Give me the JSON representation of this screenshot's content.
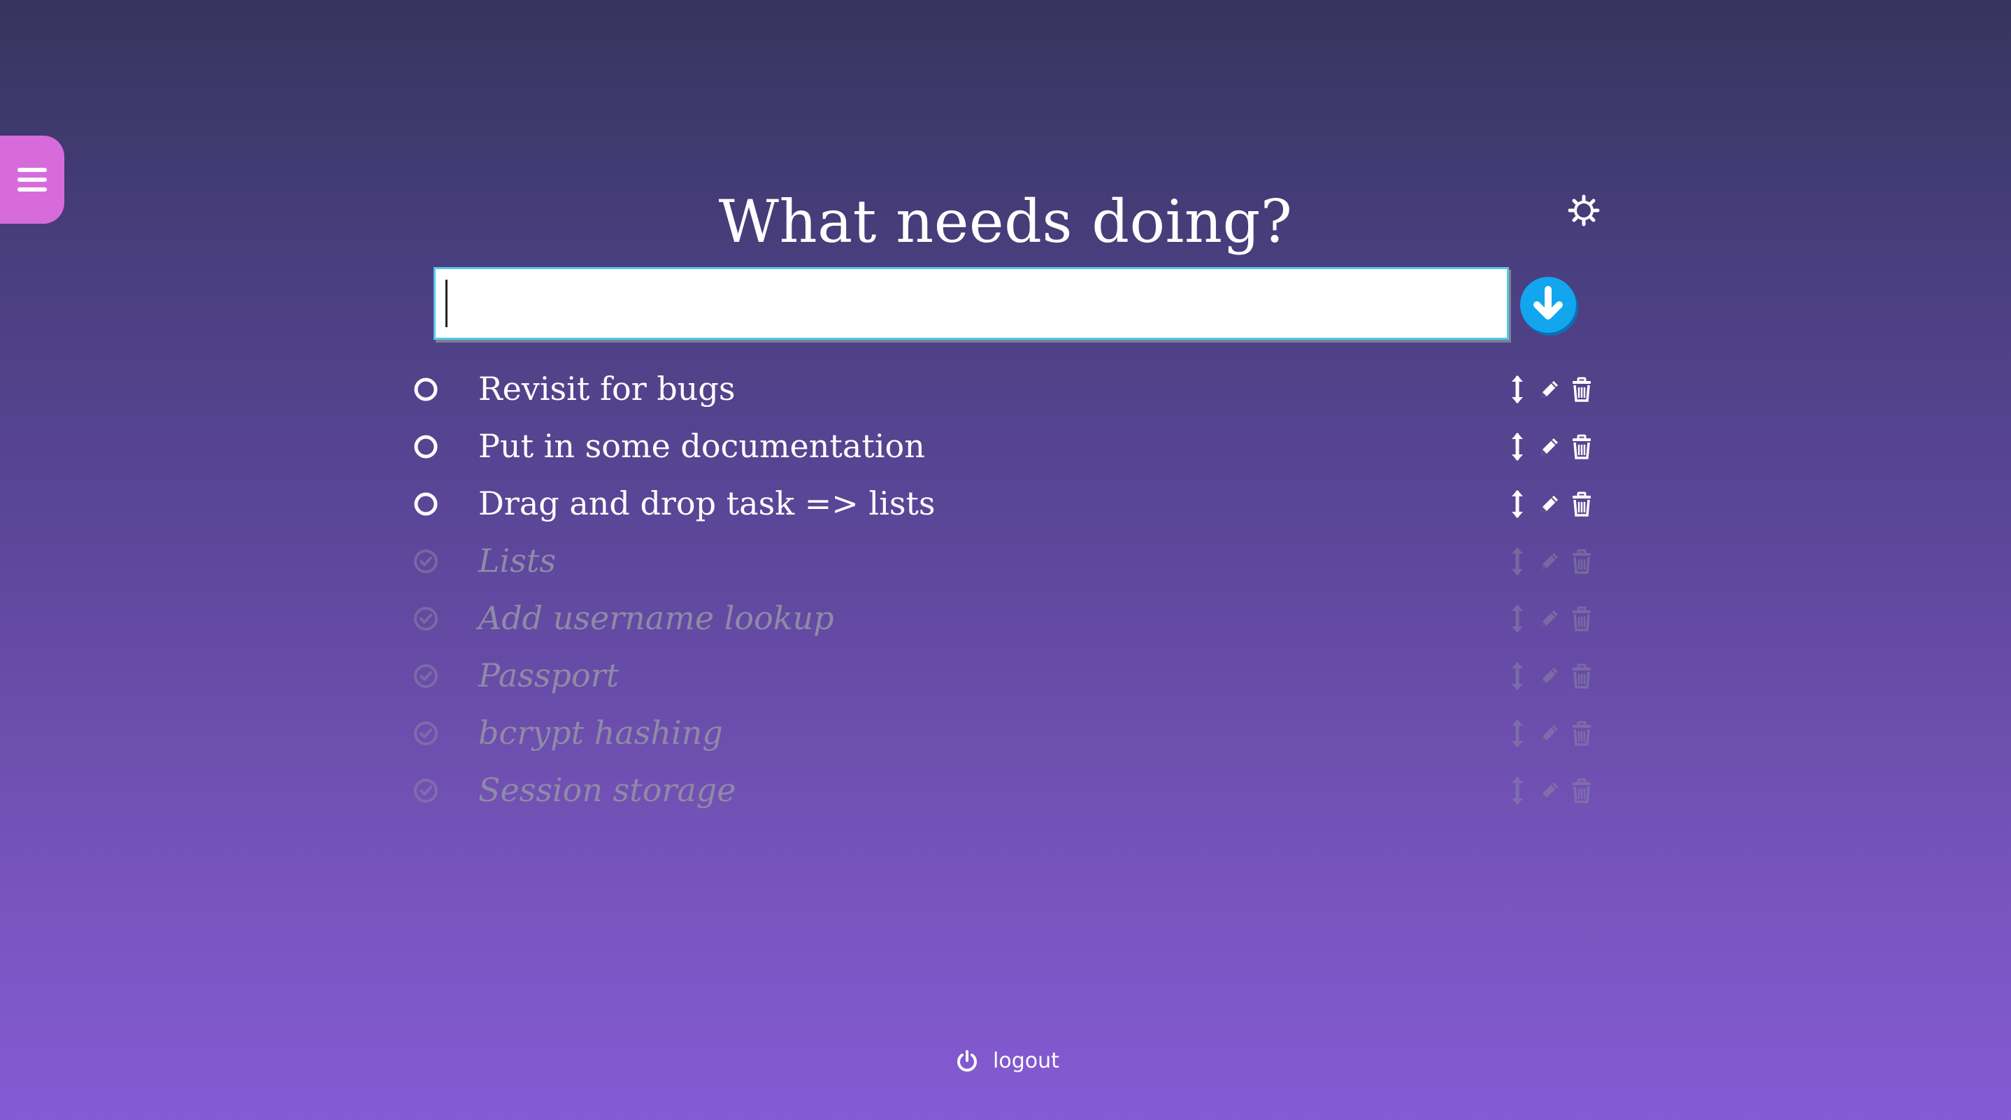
{
  "menu": {
    "icon": "hamburger-icon"
  },
  "header": {
    "title": "What needs doing?",
    "settings_icon": "gear-icon"
  },
  "input": {
    "value": "",
    "placeholder": "",
    "submit_icon": "arrow-down-circle-icon"
  },
  "colors": {
    "menu_tab": "#d76bdc",
    "submit_button": "#12a6ee",
    "input_border": "#58c8ea",
    "done_text": "#8f8aa6"
  },
  "tasks": [
    {
      "text": "Revisit for bugs",
      "done": false
    },
    {
      "text": "Put in some documentation",
      "done": false
    },
    {
      "text": "Drag and drop task => lists",
      "done": false
    },
    {
      "text": "Lists",
      "done": true
    },
    {
      "text": "Add username lookup",
      "done": true
    },
    {
      "text": "Passport",
      "done": true
    },
    {
      "text": "bcrypt hashing",
      "done": true
    },
    {
      "text": "Session storage",
      "done": true
    }
  ],
  "task_action_icons": [
    "drag-handle-icon",
    "pencil-icon",
    "trash-icon"
  ],
  "footer": {
    "logout_label": "logout",
    "logout_icon": "power-icon"
  }
}
